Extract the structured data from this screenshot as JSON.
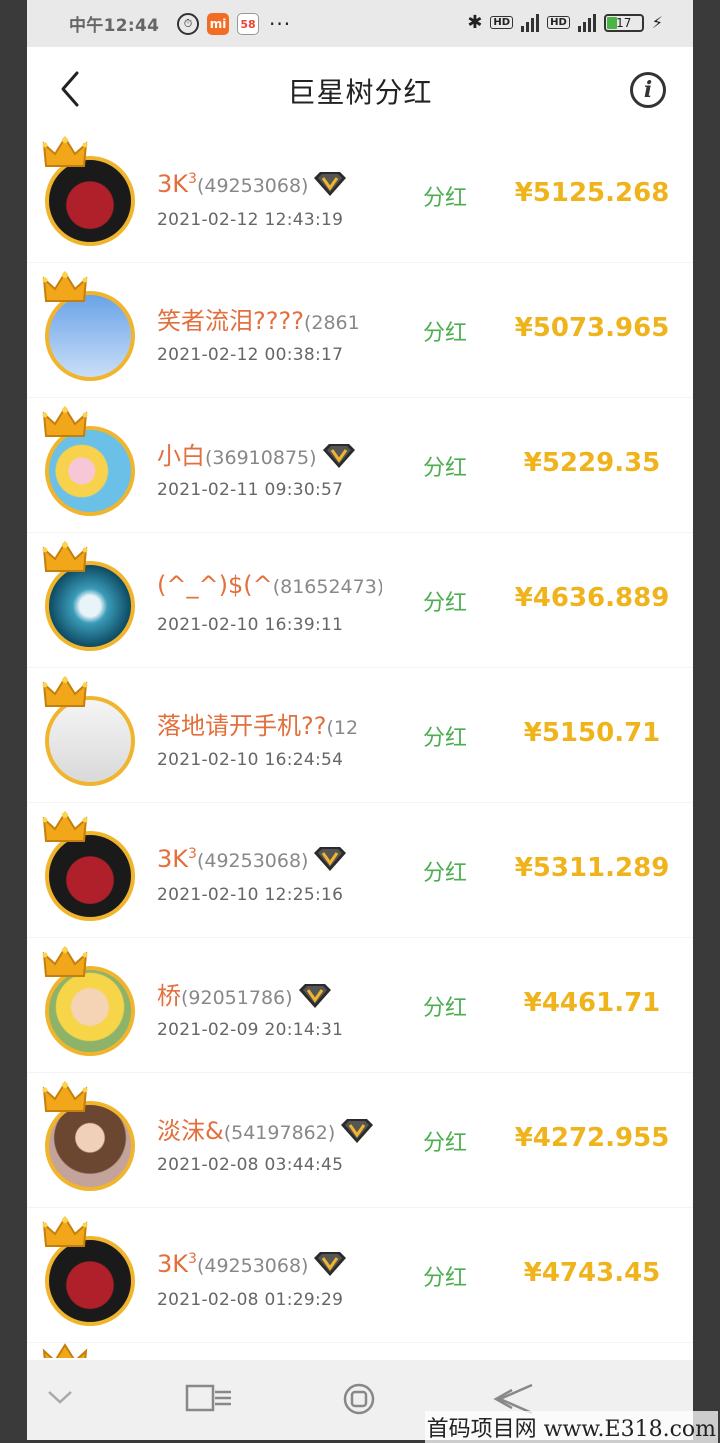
{
  "status_bar": {
    "time": "中午12:44",
    "app_icon_mi": "mi",
    "app_icon_58": "58",
    "more": "···",
    "hd": "HD",
    "battery": "17"
  },
  "header": {
    "title": "巨星树分红",
    "info_icon": "i"
  },
  "rows": [
    {
      "name": "3K",
      "sup": "3",
      "uid": "(49253068)",
      "vip": true,
      "time": "2021-02-12 12:43:19",
      "label": "分红",
      "amount": "¥5125.268",
      "avatar": "dark"
    },
    {
      "name": "笑者流泪????",
      "sup": "",
      "uid": "(2861",
      "vip": false,
      "time": "2021-02-12 00:38:17",
      "label": "分红",
      "amount": "¥5073.965",
      "avatar": "qr"
    },
    {
      "name": "小白",
      "sup": "",
      "uid": "(36910875)",
      "vip": true,
      "time": "2021-02-11 09:30:57",
      "label": "分红",
      "amount": "¥5229.35",
      "avatar": "spon"
    },
    {
      "name": "(^_^)$(^",
      "sup": "",
      "uid": "(81652473)",
      "vip": false,
      "time": "2021-02-10 16:39:11",
      "label": "分红",
      "amount": "¥4636.889",
      "avatar": "ocean"
    },
    {
      "name": "落地请开手机??",
      "sup": "",
      "uid": "(12",
      "vip": false,
      "time": "2021-02-10 16:24:54",
      "label": "分红",
      "amount": "¥5150.71",
      "avatar": "child1"
    },
    {
      "name": "3K",
      "sup": "3",
      "uid": "(49253068)",
      "vip": true,
      "time": "2021-02-10 12:25:16",
      "label": "分红",
      "amount": "¥5311.289",
      "avatar": "dark"
    },
    {
      "name": "桥",
      "sup": "",
      "uid": "(92051786)",
      "vip": true,
      "time": "2021-02-09 20:14:31",
      "label": "分红",
      "amount": "¥4461.71",
      "avatar": "child2"
    },
    {
      "name": "淡沫&",
      "sup": "",
      "uid": "(54197862)",
      "vip": true,
      "time": "2021-02-08 03:44:45",
      "label": "分红",
      "amount": "¥4272.955",
      "avatar": "girl"
    },
    {
      "name": "3K",
      "sup": "3",
      "uid": "(49253068)",
      "vip": true,
      "time": "2021-02-08 01:29:29",
      "label": "分红",
      "amount": "¥4743.45",
      "avatar": "dark"
    }
  ],
  "nav_icons": [
    "chevron-down-icon",
    "recents-icon",
    "home-icon",
    "back-triangle-icon"
  ],
  "watermark": "首码项目网 www.E318.com",
  "colors": {
    "name": "#e36f3c",
    "label": "#4cae4f",
    "amount": "#efb31c",
    "avatar_ring": "#f0b52d"
  }
}
